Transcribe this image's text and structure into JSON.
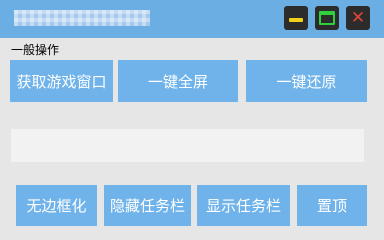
{
  "window": {
    "title": "",
    "minimize_icon": "minimize-icon",
    "maximize_icon": "maximize-icon",
    "close_icon": "close-icon",
    "close_glyph": "✕",
    "colors": {
      "titlebar": "#6aaee3",
      "minimize": "#f1d11a",
      "maximize": "#2fcf3e",
      "close": "#e0453a",
      "button": "#6fb3ea"
    }
  },
  "section": {
    "label": "一般操作"
  },
  "actions": {
    "get_window": "获取游戏窗口",
    "fullscreen": "一键全屏",
    "restore": "一键还原"
  },
  "input": {
    "value": "",
    "placeholder": ""
  },
  "taskbar_actions": {
    "borderless": "无边框化",
    "hide_taskbar": "隐藏任务栏",
    "show_taskbar": "显示任务栏",
    "pin_top": "置顶"
  }
}
